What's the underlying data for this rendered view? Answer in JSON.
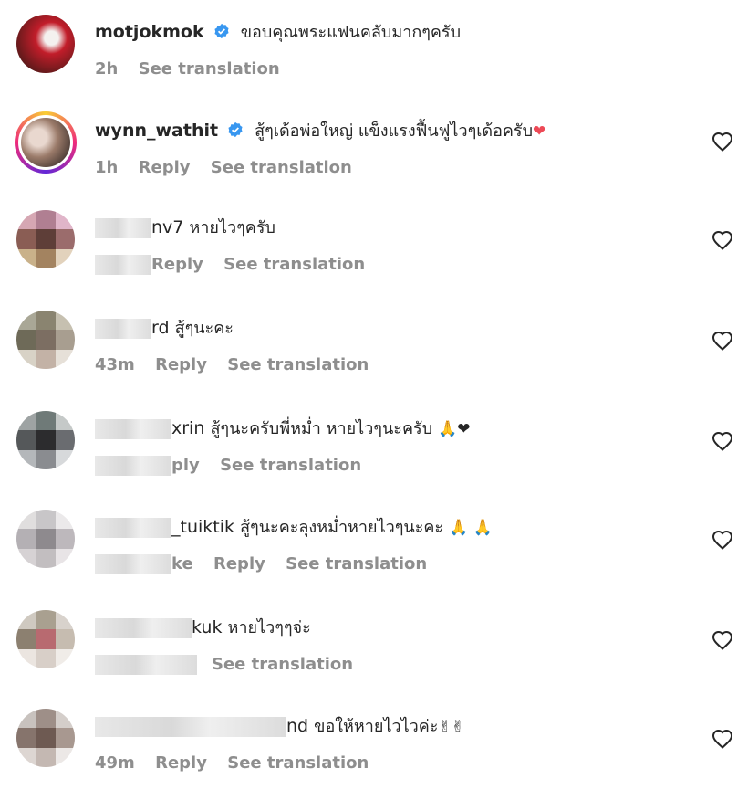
{
  "comments": [
    {
      "username": "motjokmok",
      "verified": true,
      "text": "ขอบคุณพระแฟนคลับมากๆครับ",
      "time": "2h",
      "reply": "",
      "translate": "See translation",
      "like": false
    },
    {
      "username": "wynn_wathit",
      "verified": true,
      "text": "สู้ๆเด้อพ่อใหญ่ แข็งแรงฟื้นฟูไวๆเด้อครับ",
      "emoji": "❤",
      "time": "1h",
      "reply": "Reply",
      "translate": "See translation",
      "like": true
    },
    {
      "username": "nv7",
      "text": "หายไวๆครับ",
      "time": "",
      "reply": "Reply",
      "translate": "See translation",
      "like": true
    },
    {
      "username": "rd",
      "text": "สู้ๆนะคะ",
      "time": "43m",
      "reply": "Reply",
      "translate": "See translation",
      "like": true
    },
    {
      "username": "xrin",
      "text": "สู้ๆนะครับพี่หม่ำ หายไวๆนะครับ",
      "emoji": "🙏❤",
      "time": "",
      "reply": "ply",
      "translate": "See translation",
      "like": true
    },
    {
      "username": "_tuiktik",
      "text": "สู้ๆนะคะลุงหม่ำหายไวๆนะคะ",
      "emoji": "🙏 🙏",
      "time": "",
      "like_label": "ke",
      "reply": "Reply",
      "translate": "See translation",
      "like": true
    },
    {
      "username": "kuk",
      "text": "หายไวๆๆจ่ะ",
      "time": "",
      "reply": "",
      "translate": "See translation",
      "like": true
    },
    {
      "username": "nd",
      "text": "ขอให้หายไวไวค่ะ",
      "emoji": "✌✌",
      "time": "49m",
      "reply": "Reply",
      "translate": "See translation",
      "like": true
    }
  ],
  "colors": {
    "verified": "#3897f0",
    "muted": "#8e8e8e",
    "heart_red": "#ed4956"
  }
}
